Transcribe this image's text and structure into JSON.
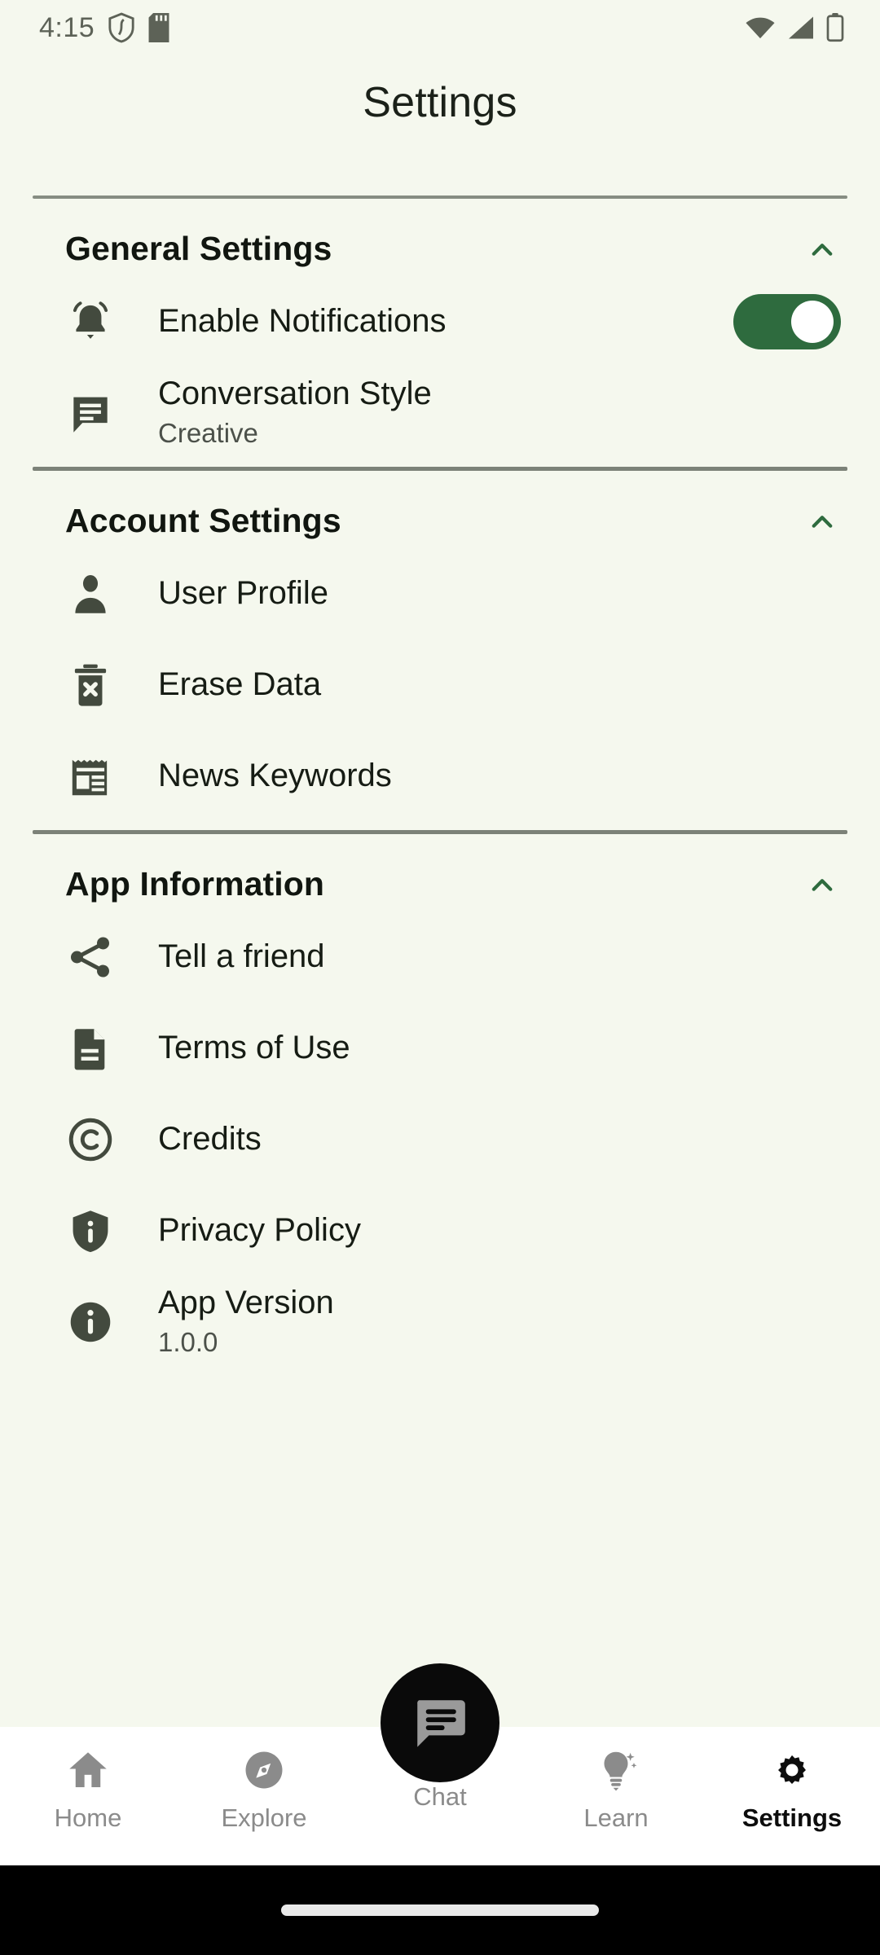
{
  "statusbar": {
    "time": "4:15",
    "left_icons": [
      "shield-icon",
      "sd-card-icon"
    ],
    "right_icons": [
      "wifi-icon",
      "cellular-signal-icon",
      "battery-icon"
    ]
  },
  "header": {
    "title": "Settings"
  },
  "colors": {
    "background": "#f5f8ee",
    "toggle_on": "#2e6b3e",
    "chevron": "#2e6b3e",
    "icon": "#434a3e",
    "divider": "#7c8278",
    "nav_inactive": "#8b8b8b",
    "nav_active": "#0d0d0d",
    "fab_background": "#0a0a0a"
  },
  "sections": [
    {
      "id": "general-settings",
      "title": "General Settings",
      "expanded": true,
      "chevron_icon": "chevron-up-icon",
      "rows": [
        {
          "id": "enable-notifications",
          "icon": "bell-icon",
          "label": "Enable Notifications",
          "sub": "",
          "control": "toggle",
          "toggle_on": true
        },
        {
          "id": "conversation-style",
          "icon": "chat-bubble-icon",
          "label": "Conversation Style",
          "sub": "Creative",
          "control": "none"
        }
      ]
    },
    {
      "id": "account-settings",
      "title": "Account Settings",
      "expanded": true,
      "chevron_icon": "chevron-up-icon",
      "rows": [
        {
          "id": "user-profile",
          "icon": "person-icon",
          "label": "User Profile",
          "sub": "",
          "control": "none"
        },
        {
          "id": "erase-data",
          "icon": "trash-x-icon",
          "label": "Erase Data",
          "sub": "",
          "control": "none"
        },
        {
          "id": "news-keywords",
          "icon": "newspaper-icon",
          "label": "News Keywords",
          "sub": "",
          "control": "none"
        }
      ]
    },
    {
      "id": "app-information",
      "title": "App Information",
      "expanded": true,
      "chevron_icon": "chevron-up-icon",
      "rows": [
        {
          "id": "tell-a-friend",
          "icon": "share-icon",
          "label": "Tell a friend",
          "sub": "",
          "control": "none"
        },
        {
          "id": "terms-of-use",
          "icon": "document-icon",
          "label": "Terms of Use",
          "sub": "",
          "control": "none"
        },
        {
          "id": "credits",
          "icon": "copyright-icon",
          "label": "Credits",
          "sub": "",
          "control": "none"
        },
        {
          "id": "privacy-policy",
          "icon": "shield-info-icon",
          "label": "Privacy Policy",
          "sub": "",
          "control": "none"
        },
        {
          "id": "app-version",
          "icon": "info-circle-icon",
          "label": "App Version",
          "sub": "1.0.0",
          "control": "none"
        }
      ]
    }
  ],
  "bottom_nav": {
    "items": [
      {
        "id": "home",
        "label": "Home",
        "icon": "home-icon",
        "active": false
      },
      {
        "id": "explore",
        "label": "Explore",
        "icon": "compass-icon",
        "active": false
      },
      {
        "id": "chat",
        "label": "Chat",
        "icon": "chat-fab-icon",
        "active": false
      },
      {
        "id": "learn",
        "label": "Learn",
        "icon": "bulb-icon",
        "active": false
      },
      {
        "id": "settings",
        "label": "Settings",
        "icon": "gear-icon",
        "active": true
      }
    ]
  }
}
